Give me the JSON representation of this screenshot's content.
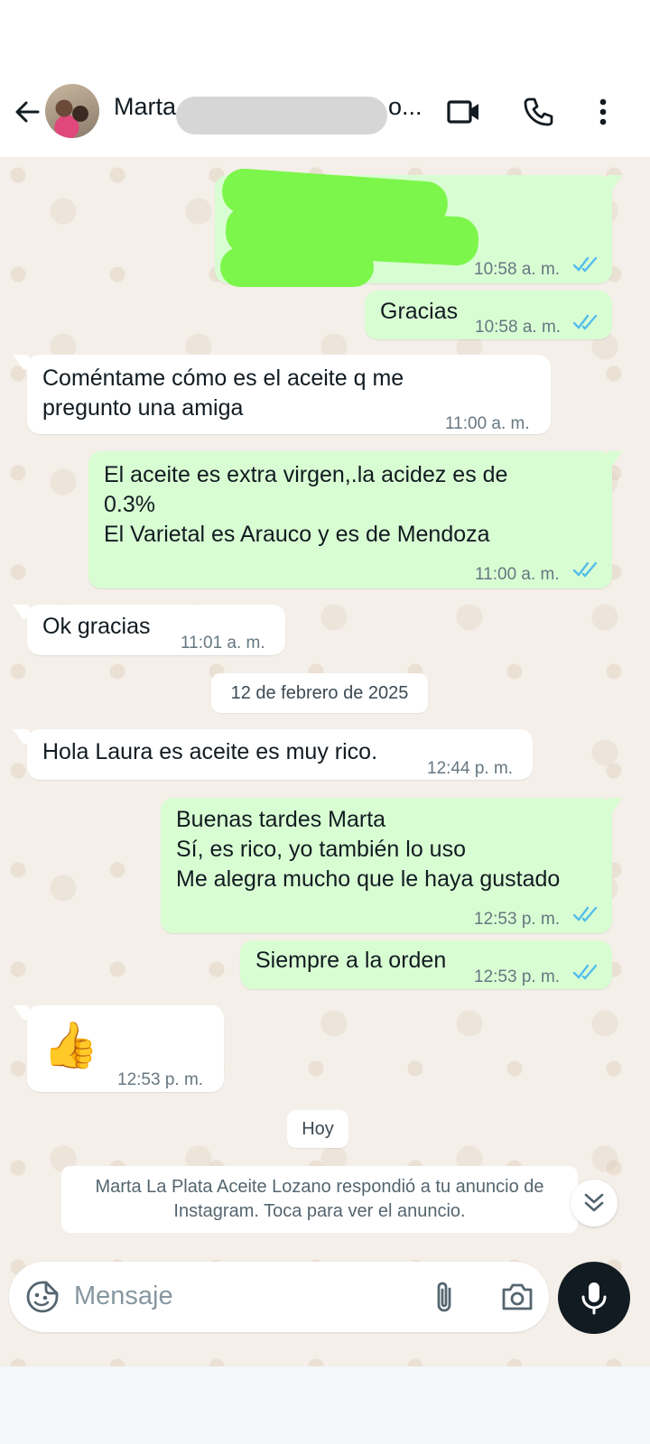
{
  "header": {
    "contact_name_visible": "Marta",
    "contact_name_tail": "o..."
  },
  "messages": [
    {
      "dir": "out",
      "text": "",
      "time": "10:58 a. m.",
      "status": "read"
    },
    {
      "dir": "out",
      "text": "Gracias",
      "time": "10:58 a. m.",
      "status": "read"
    },
    {
      "dir": "in",
      "text": "Coméntame cómo es el aceite q me\npregunto una amiga",
      "time": "11:00 a. m."
    },
    {
      "dir": "out",
      "text": "El aceite es extra virgen,.la acidez es de\n0.3%\nEl Varietal es Arauco y es de Mendoza",
      "time": "11:00 a. m.",
      "status": "read"
    },
    {
      "dir": "in",
      "text": "Ok gracias",
      "time": "11:01 a. m."
    },
    {
      "dir": "in",
      "text": "Hola Laura es aceite es muy rico.",
      "time": "12:44 p. m."
    },
    {
      "dir": "out",
      "text": "Buenas tardes Marta\nSí, es rico, yo también lo uso\nMe alegra mucho que le haya gustado",
      "time": "12:53 p. m.",
      "status": "read"
    },
    {
      "dir": "out",
      "text": "Siempre a la orden",
      "time": "12:53 p. m.",
      "status": "read"
    },
    {
      "dir": "in",
      "text": "👍",
      "time": "12:53 p. m."
    }
  ],
  "date_chips": [
    "12 de febrero de 2025",
    "Hoy"
  ],
  "ad_notice": "Marta La Plata Aceite Lozano respondió a tu anuncio de\nInstagram. Toca para ver el anuncio.",
  "composer": {
    "placeholder": "Mensaje"
  },
  "colors": {
    "outgoing_bubble": "#d9fdd3",
    "incoming_bubble": "#ffffff",
    "chat_background": "#f4efe8",
    "read_ticks": "#53bdeb"
  }
}
